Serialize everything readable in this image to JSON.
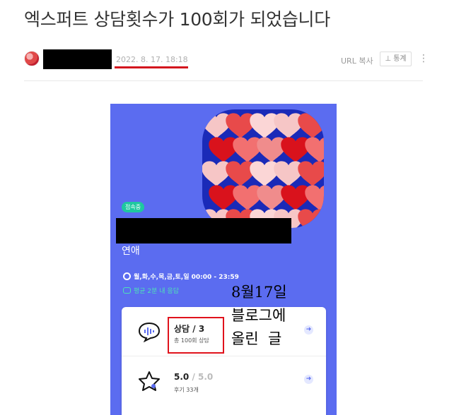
{
  "post": {
    "title": "엑스퍼트 상담횟수가 100회가 되었습니다",
    "date": "2022. 8. 17. 18:18",
    "url_copy": "URL 복사",
    "stats_label": "⊥ 통계",
    "more_icon": "more-vertical-icon"
  },
  "embed": {
    "status_badge": "접속중",
    "category": "연애",
    "hours": "월,화,수,목,금,토,일  00:00 - 23:59",
    "reply": "평균 2분 내 응답",
    "consult": {
      "label": "상담",
      "sep": " / ",
      "count": "3",
      "total": "총 100회 상담"
    },
    "rating": {
      "score": "5.0",
      "max": " / 5.0",
      "reviews": "후기 33개"
    },
    "colors": {
      "accent": "#5b6cf0",
      "highlight": "#e0121c",
      "online": "#1ec8a0"
    }
  },
  "annotation": {
    "line1": "8월17일",
    "line2": "블로그에",
    "line3": "올린  글"
  }
}
